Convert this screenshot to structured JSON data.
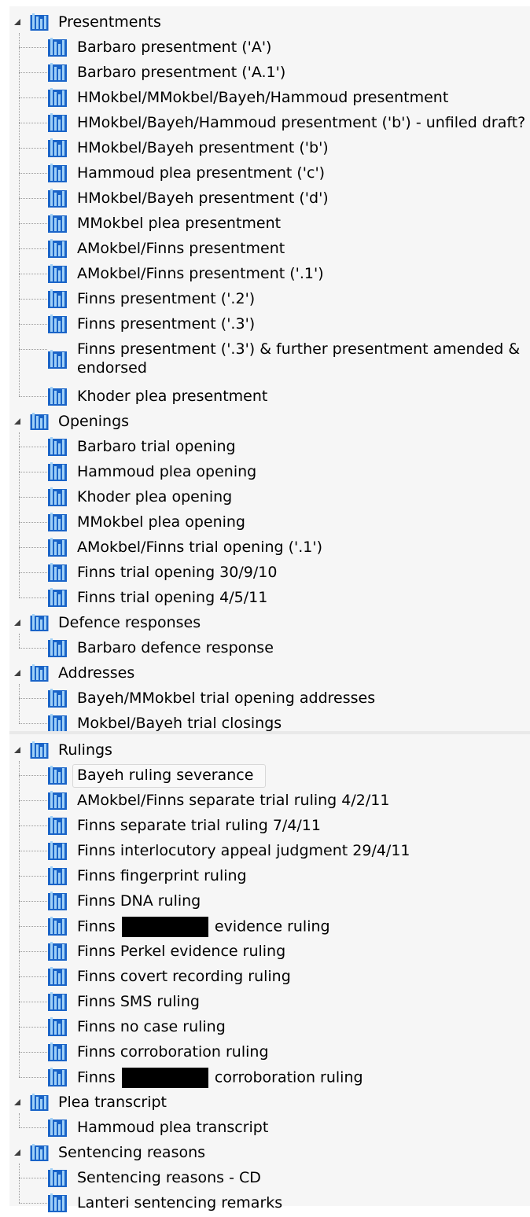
{
  "tree_top": [
    {
      "label": "Presentments",
      "children": [
        "Barbaro presentment ('A')",
        "Barbaro presentment ('A.1')",
        "HMokbel/MMokbel/Bayeh/Hammoud presentment",
        "HMokbel/Bayeh/Hammoud presentment ('b') - unfiled draft?",
        "HMokbel/Bayeh presentment ('b')",
        "Hammoud plea presentment ('c')",
        "HMokbel/Bayeh presentment ('d')",
        "MMokbel plea presentment",
        "AMokbel/Finns presentment",
        "AMokbel/Finns presentment ('.1')",
        "Finns presentment ('.2')",
        "Finns presentment ('.3')",
        "Finns presentment ('.3') & further presentment amended & endorsed",
        "Khoder plea presentment"
      ]
    },
    {
      "label": "Openings",
      "children": [
        "Barbaro trial opening",
        "Hammoud plea opening",
        "Khoder plea opening",
        "MMokbel plea opening",
        "AMokbel/Finns trial opening ('.1')",
        "Finns trial opening 30/9/10",
        "Finns trial opening 4/5/11"
      ]
    },
    {
      "label": "Defence responses",
      "children": [
        "Barbaro defence response"
      ]
    },
    {
      "label": "Addresses",
      "children": [
        "Bayeh/MMokbel trial opening addresses",
        "Mokbel/Bayeh trial closings"
      ]
    }
  ],
  "tree_bottom": [
    {
      "label": "Rulings",
      "children": [
        "Bayeh ruling severance",
        "AMokbel/Finns separate trial ruling 4/2/11",
        "Finns separate trial ruling 7/4/11",
        "Finns interlocutory appeal judgment 29/4/11",
        "Finns fingerprint ruling",
        "Finns DNA ruling",
        "Finns [redacted] evidence ruling",
        "Finns Perkel evidence ruling",
        "Finns covert recording ruling",
        "Finns SMS ruling",
        "Finns no case ruling",
        "Finns corroboration ruling",
        "Finns [redacted] corroboration ruling"
      ]
    },
    {
      "label": "Plea transcript",
      "children": [
        "Hammoud plea transcript"
      ]
    },
    {
      "label": "Sentencing reasons",
      "children": [
        "Sentencing reasons - CD",
        "Lanteri sentencing remarks"
      ]
    }
  ],
  "selected_item": "Bayeh ruling severance",
  "colors": {
    "icon_blue": "#1a64c8",
    "icon_light": "#9fd0f7",
    "line": "#9a9a9a"
  }
}
